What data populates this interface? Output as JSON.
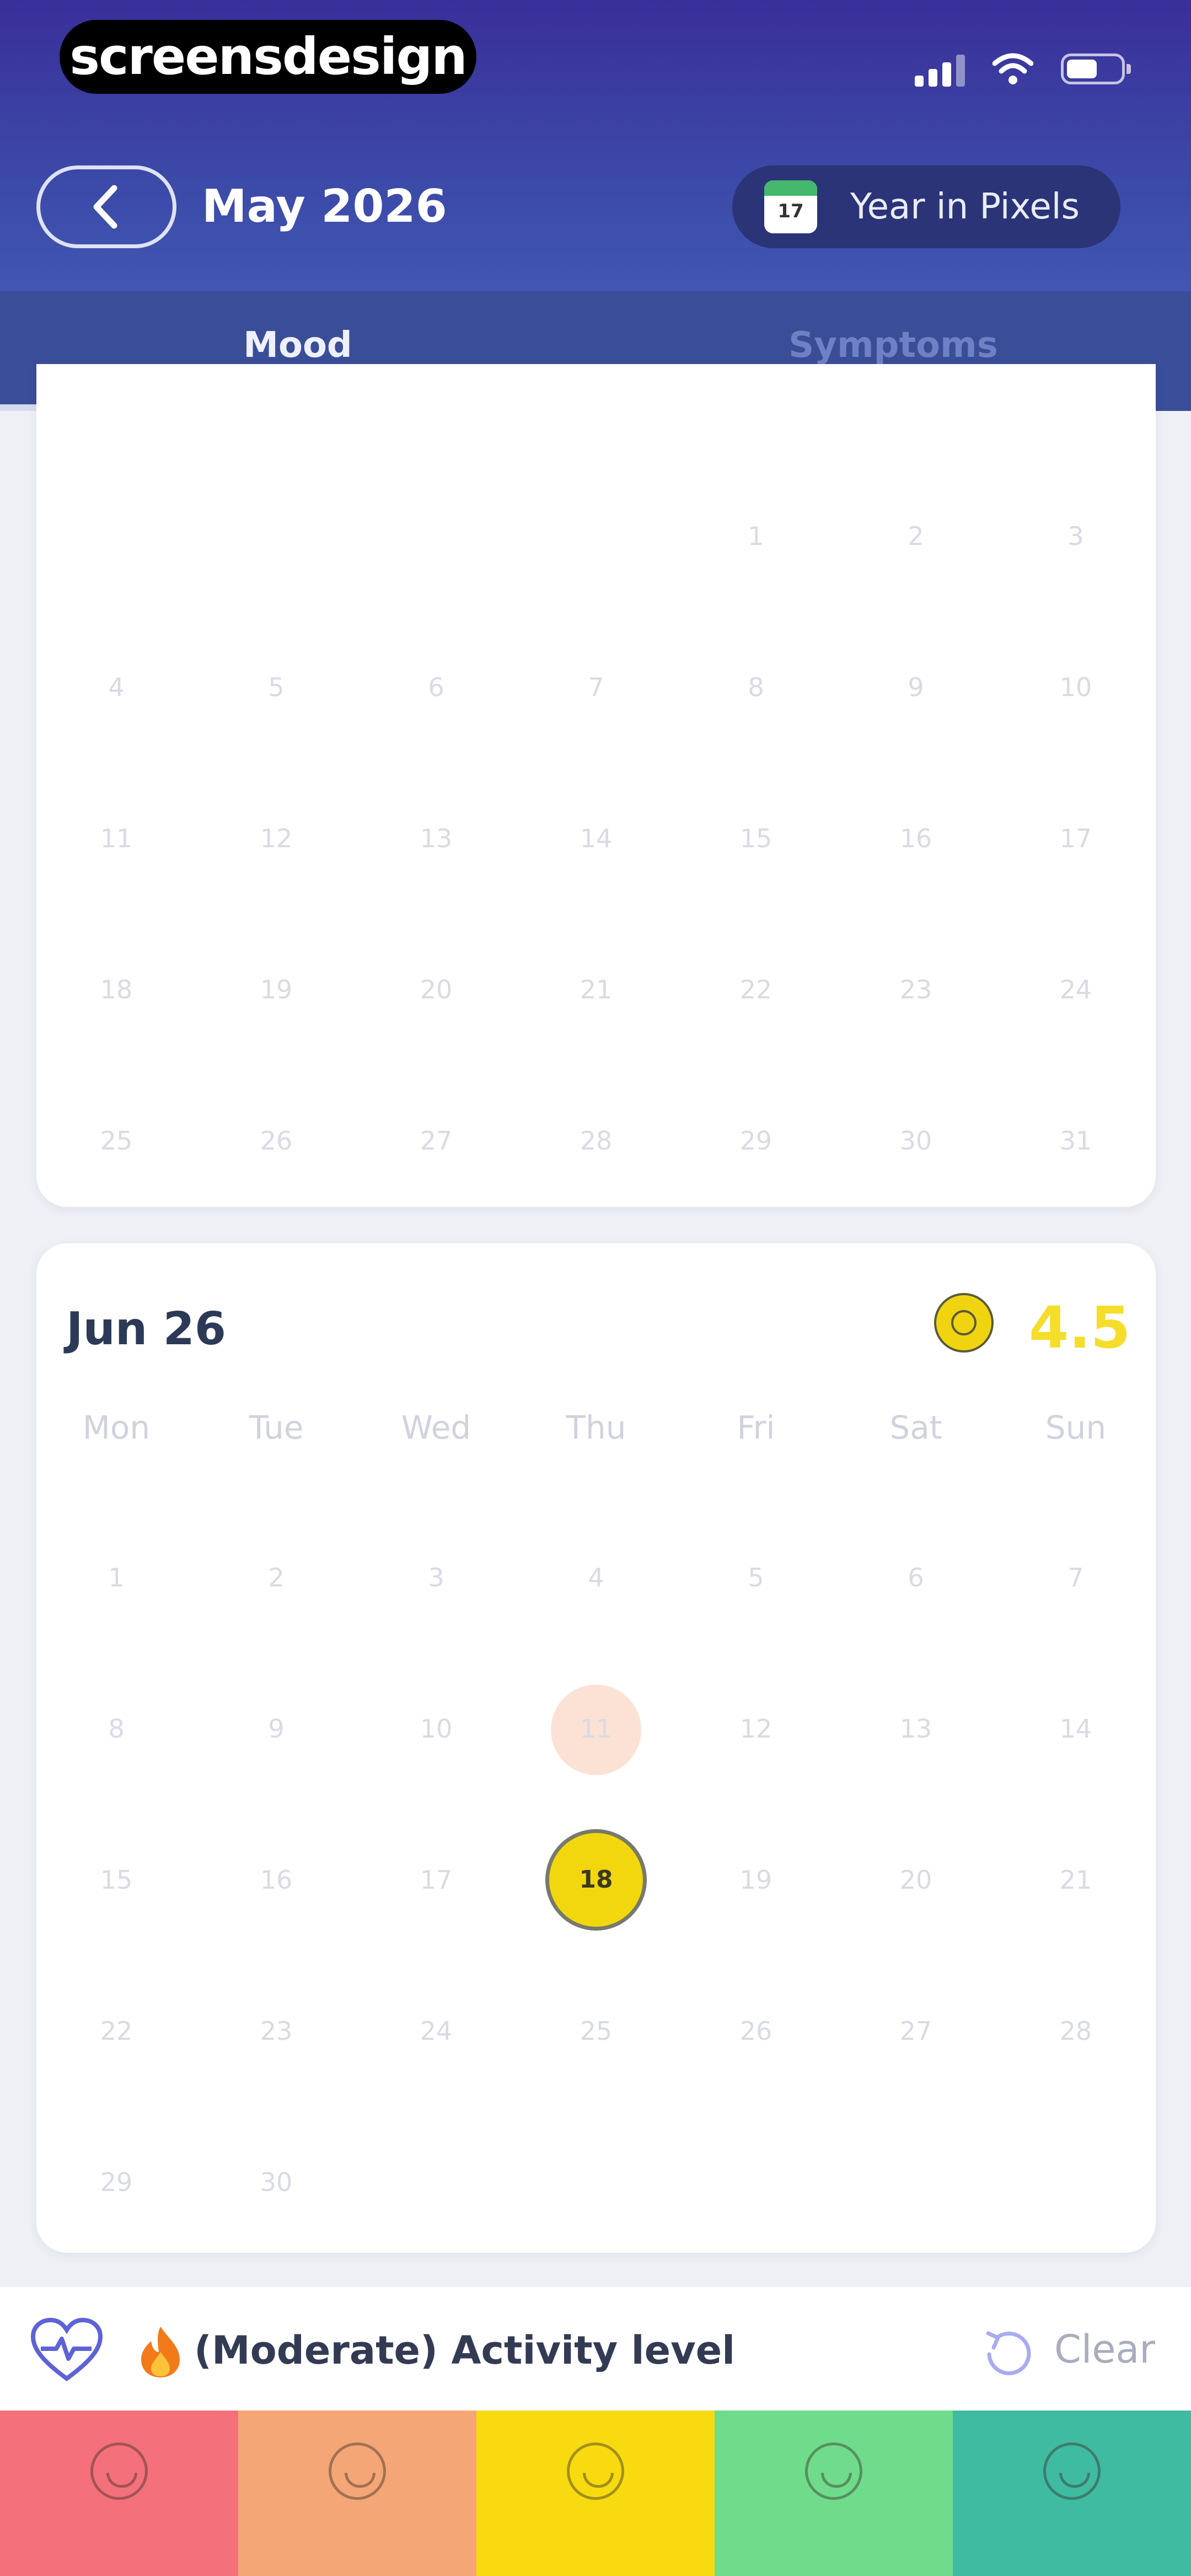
{
  "status_bar": {
    "brand": "screensdesign"
  },
  "header": {
    "month_title": "May 2026",
    "year_pixels_label": "Year in Pixels",
    "calendar_icon_number": "17"
  },
  "tabs": [
    {
      "label": "Mood",
      "active": true
    },
    {
      "label": "Symptoms",
      "active": false
    }
  ],
  "may_calendar": {
    "weeks": [
      [
        "",
        "",
        "",
        "",
        "1",
        "2",
        "3"
      ],
      [
        "4",
        "5",
        "6",
        "7",
        "8",
        "9",
        "10"
      ],
      [
        "11",
        "12",
        "13",
        "14",
        "15",
        "16",
        "17"
      ],
      [
        "18",
        "19",
        "20",
        "21",
        "22",
        "23",
        "24"
      ],
      [
        "25",
        "26",
        "27",
        "28",
        "29",
        "30",
        "31"
      ]
    ]
  },
  "jun_calendar": {
    "title": "Jun 26",
    "average_score": "4.5",
    "weekdays": [
      "Mon",
      "Tue",
      "Wed",
      "Thu",
      "Fri",
      "Sat",
      "Sun"
    ],
    "weeks": [
      [
        "1",
        "2",
        "3",
        "4",
        "5",
        "6",
        "7"
      ],
      [
        "8",
        "9",
        "10",
        "11",
        "12",
        "13",
        "14"
      ],
      [
        "15",
        "16",
        "17",
        "18",
        "19",
        "20",
        "21"
      ],
      [
        "22",
        "23",
        "24",
        "25",
        "26",
        "27",
        "28"
      ],
      [
        "29",
        "30",
        "",
        "",
        "",
        "",
        ""
      ]
    ],
    "today": "11",
    "selected_day": "18"
  },
  "filter_bar": {
    "activity_label": "(Moderate) Activity level",
    "clear_label": "Clear"
  },
  "mood_colors": [
    "#f4707a",
    "#f5a676",
    "#f7db10",
    "#6fdc8c",
    "#3fbba2"
  ],
  "colors": {
    "header_top": "#3a2f9a",
    "tab_bar": "#3a4e97",
    "selected_mood": "#f2d70f",
    "score": "#f5dd2a"
  }
}
